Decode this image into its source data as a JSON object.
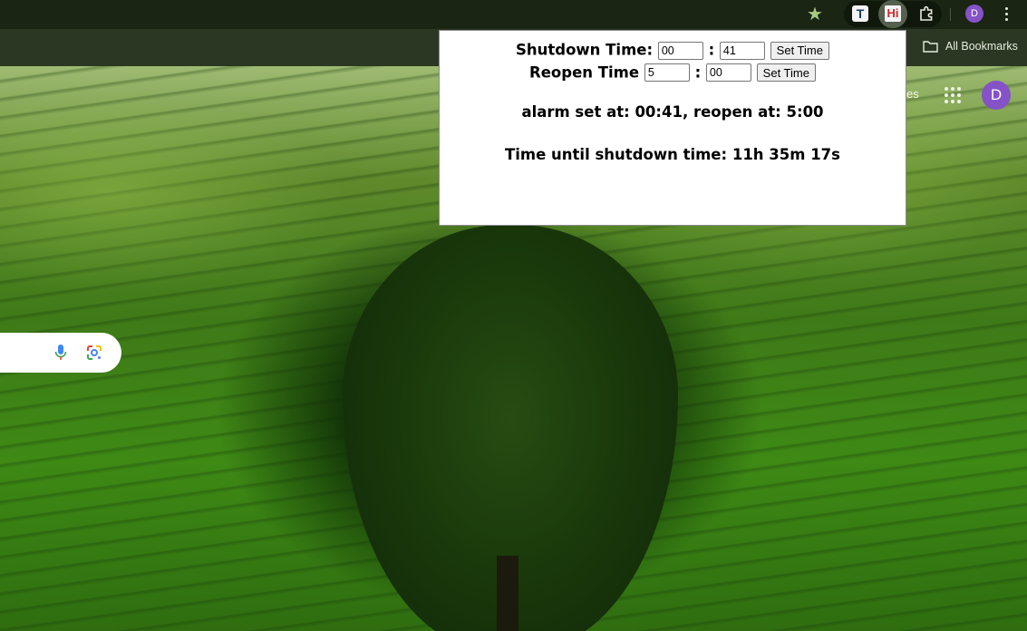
{
  "browser": {
    "bookmarks_label": "All Bookmarks",
    "profile_initial": "D",
    "extensions": [
      {
        "name": "t-extension-icon",
        "glyph": "T"
      },
      {
        "name": "hi-extension-icon",
        "glyph": "Hi"
      }
    ]
  },
  "ntp": {
    "text_fragment": "es",
    "profile_initial": "D"
  },
  "popup": {
    "shutdown": {
      "label": "Shutdown Time:",
      "hour": "00",
      "minute": "41",
      "button": "Set Time"
    },
    "reopen": {
      "label": "Reopen Time",
      "hour": "5",
      "minute": "00",
      "button": "Set Time"
    },
    "separator": ":",
    "status": "alarm set at: 00:41, reopen at: 5:00",
    "countdown": "Time until shutdown time: 11h 35m 17s"
  },
  "colors": {
    "avatar": "#8552c7",
    "chrome": "#1b2514",
    "bookmarks_bar": "#2b3723"
  }
}
